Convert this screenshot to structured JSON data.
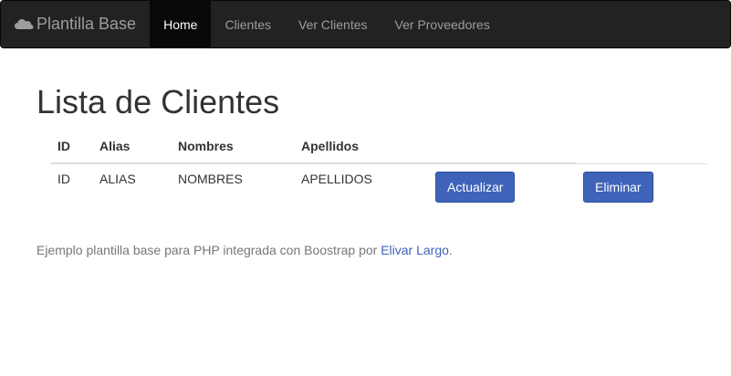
{
  "navbar": {
    "brand": "Plantilla Base",
    "brand_icon": "cloud-icon",
    "items": [
      {
        "label": "Home",
        "active": true
      },
      {
        "label": "Clientes",
        "active": false
      },
      {
        "label": "Ver Clientes",
        "active": false
      },
      {
        "label": "Ver Proveedores",
        "active": false
      }
    ]
  },
  "page": {
    "title": "Lista de Clientes"
  },
  "table": {
    "headers": [
      "ID",
      "Alias",
      "Nombres",
      "Apellidos"
    ],
    "rows": [
      {
        "id": "ID",
        "alias": "ALIAS",
        "nombres": "NOMBRES",
        "apellidos": "APELLIDOS",
        "update_label": "Actualizar",
        "delete_label": "Eliminar"
      }
    ]
  },
  "footer": {
    "text": "Ejemplo plantilla base para PHP integrada con Boostrap por ",
    "link_text": "Elivar Largo",
    "suffix": "."
  },
  "colors": {
    "navbar_bg": "#222222",
    "button_primary": "#3e63b9",
    "link": "#3e63b9"
  }
}
